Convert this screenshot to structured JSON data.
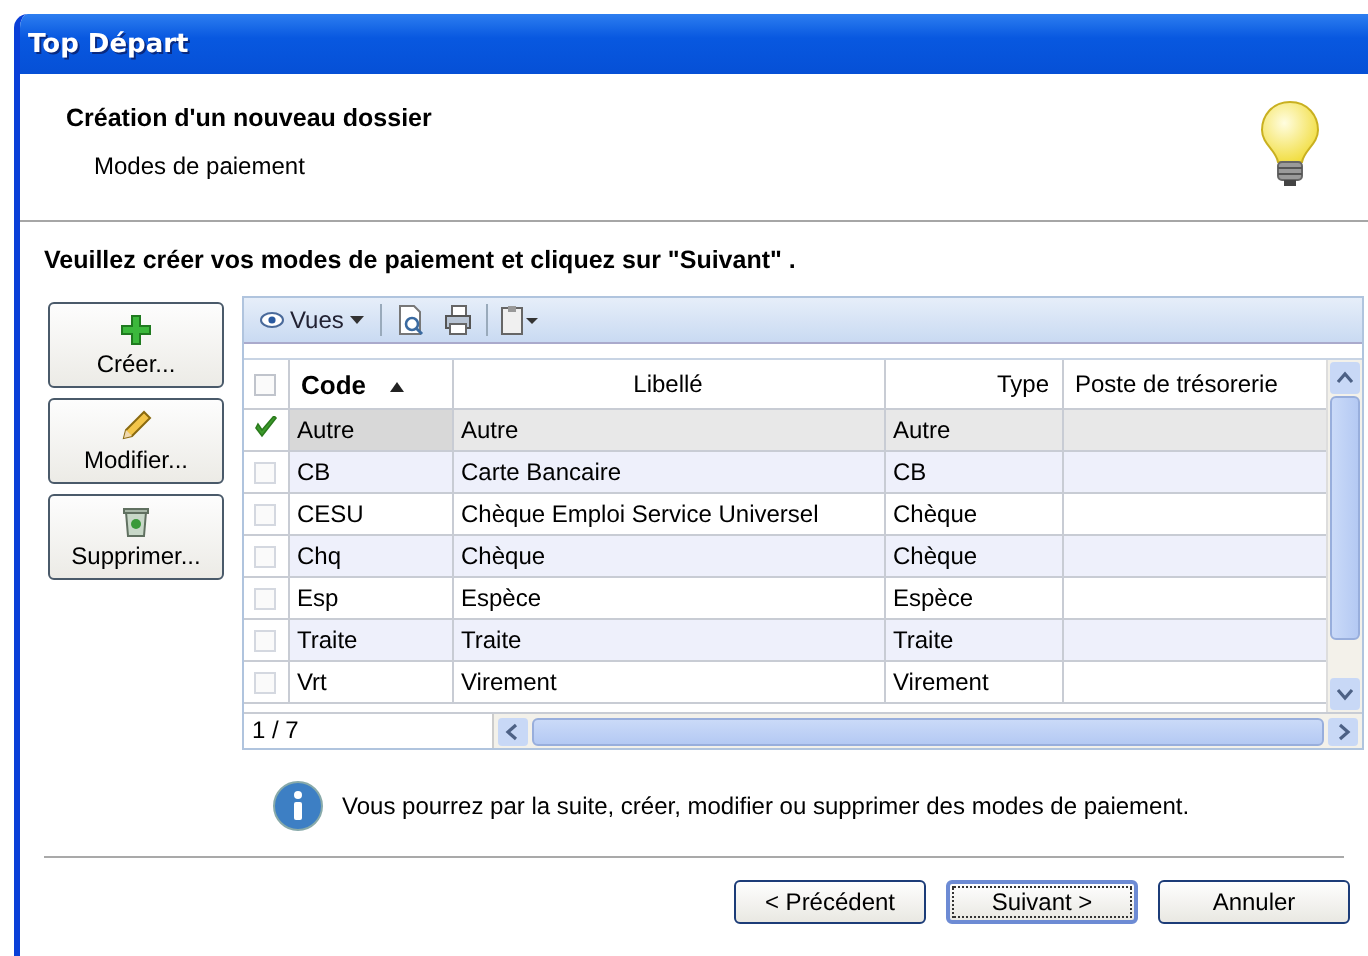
{
  "window": {
    "title": "Top Départ"
  },
  "header": {
    "title": "Création d'un nouveau dossier",
    "subtitle": "Modes de paiement"
  },
  "instruction": "Veuillez créer vos modes de paiement et cliquez sur \"Suivant\" .",
  "side_buttons": [
    {
      "kind": "create",
      "label": "Créer..."
    },
    {
      "kind": "edit",
      "label": "Modifier..."
    },
    {
      "kind": "delete",
      "label": "Supprimer..."
    }
  ],
  "toolbar": {
    "views_label": "Vues"
  },
  "table": {
    "select_all": {
      "checked": false
    },
    "columns": [
      {
        "label": "Code",
        "sorted": true
      },
      {
        "label": "Libellé",
        "sorted": false
      },
      {
        "label": "Type",
        "sorted": false
      },
      {
        "label": "Poste de trésorerie",
        "sorted": false
      }
    ],
    "rows": [
      {
        "selected": true,
        "cells": [
          "Autre",
          "Autre",
          "Autre",
          ""
        ]
      },
      {
        "selected": false,
        "cells": [
          "CB",
          "Carte Bancaire",
          "CB",
          ""
        ]
      },
      {
        "selected": false,
        "cells": [
          "CESU",
          "Chèque Emploi Service Universel",
          "Chèque",
          ""
        ]
      },
      {
        "selected": false,
        "cells": [
          "Chq",
          "Chèque",
          "Chèque",
          ""
        ]
      },
      {
        "selected": false,
        "cells": [
          "Esp",
          "Espèce",
          "Espèce",
          ""
        ]
      },
      {
        "selected": false,
        "cells": [
          "Traite",
          "Traite",
          "Traite",
          ""
        ]
      },
      {
        "selected": false,
        "cells": [
          "Vrt",
          "Virement",
          "Virement",
          ""
        ]
      }
    ],
    "record_counter": "1 / 7"
  },
  "info": "Vous pourrez par la suite, créer, modifier ou supprimer des modes de paiement.",
  "buttons": [
    {
      "label": "< Précédent",
      "default": false
    },
    {
      "label": "Suivant >",
      "default": true
    },
    {
      "label": "Annuler",
      "default": false
    }
  ]
}
